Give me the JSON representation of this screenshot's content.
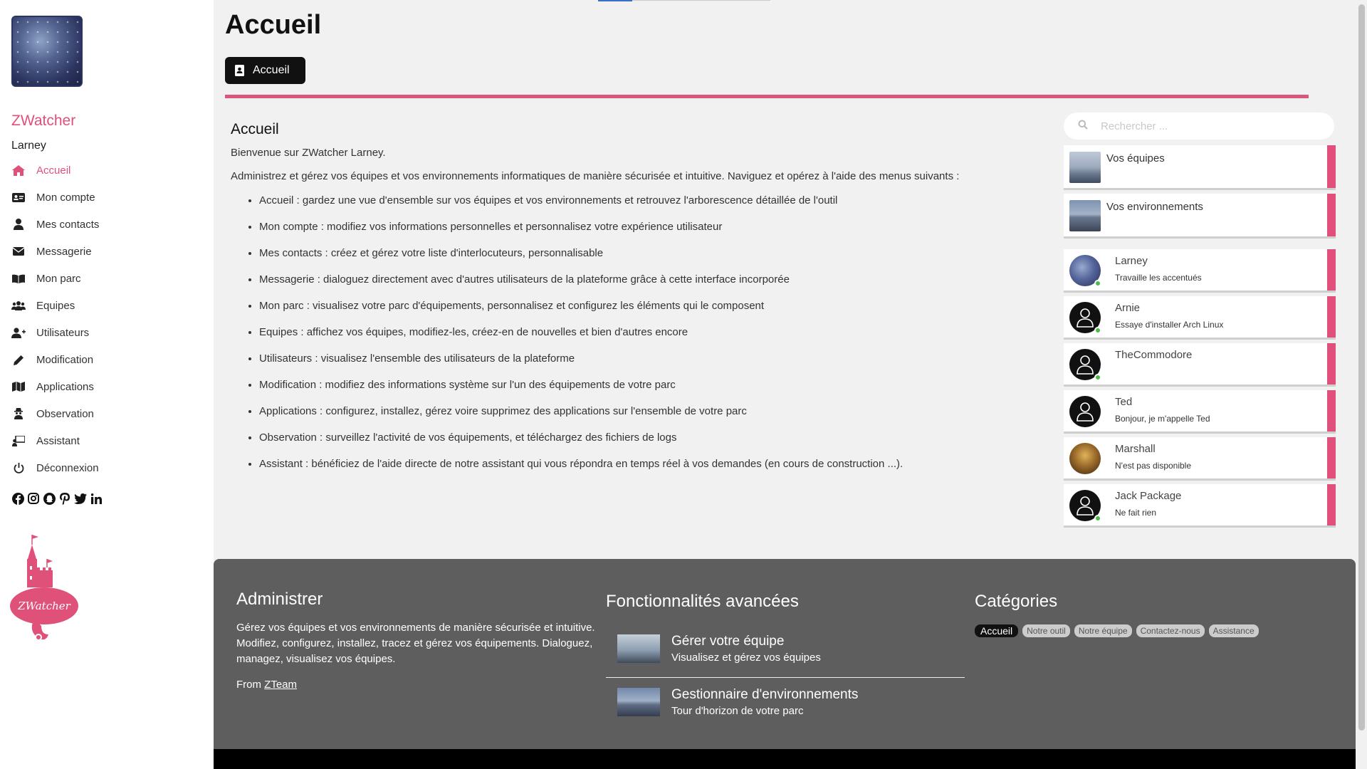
{
  "sidebar": {
    "app_name": "ZWatcher",
    "user_name": "Larney",
    "nav": [
      {
        "label": "Accueil",
        "icon": "home-icon",
        "active": true
      },
      {
        "label": "Mon compte",
        "icon": "id-card-icon"
      },
      {
        "label": "Mes contacts",
        "icon": "user-icon"
      },
      {
        "label": "Messagerie",
        "icon": "envelope-icon"
      },
      {
        "label": "Mon parc",
        "icon": "book-open-icon"
      },
      {
        "label": "Equipes",
        "icon": "users-icon"
      },
      {
        "label": "Utilisateurs",
        "icon": "user-plus-icon"
      },
      {
        "label": "Modification",
        "icon": "pencil-icon"
      },
      {
        "label": "Applications",
        "icon": "map-icon"
      },
      {
        "label": "Observation",
        "icon": "user-secret-icon"
      },
      {
        "label": "Assistant",
        "icon": "chalkboard-user-icon"
      },
      {
        "label": "Déconnexion",
        "icon": "power-icon"
      }
    ],
    "socials": [
      "facebook-icon",
      "instagram-icon",
      "snapchat-icon",
      "pinterest-icon",
      "twitter-icon",
      "linkedin-icon"
    ],
    "logo_text": "ZWatcher"
  },
  "header": {
    "title": "Accueil",
    "button_label": "Accueil"
  },
  "content": {
    "heading": "Accueil",
    "welcome": "Bienvenue sur ZWatcher Larney.",
    "intro": "Administrez et gérez vos équipes et vos environnements informatiques de manière sécurisée et intuitive. Naviguez et opérez à l'aide des menus suivants :",
    "items": [
      "Accueil : gardez une vue d'ensemble sur vos équipes et vos environnements et retrouvez l'arborescence détaillée de l'outil",
      "Mon compte : modifiez vos informations personnelles et personnalisez votre expérience utilisateur",
      "Mes contacts : créez et gérez votre liste d'interlocuteurs, personnalisable",
      "Messagerie : dialoguez directement avec d'autres utilisateurs de la plateforme grâce à cette interface incorporée",
      "Mon parc : visualisez votre parc d'équipements, personnalisez et configurez les éléments qui le composent",
      "Equipes : affichez vos équipes, modifiez-les, créez-en de nouvelles et bien d'autres encore",
      "Utilisateurs : visualisez l'ensemble des utilisateurs de la plateforme",
      "Modification : modifiez des informations système sur l'un des équipements de votre parc",
      "Applications : configurez, installez, gérez voire supprimez des applications sur l'ensemble de votre parc",
      "Observation : surveillez l'activité de vos équipements, et téléchargez des fichiers de logs",
      "Assistant : bénéficiez de l'aide directe de notre assistant qui vous répondra en temps réel à vos demandes (en cours de construction ...)."
    ]
  },
  "right_panel": {
    "search_placeholder": "Rechercher ...",
    "quick_links": [
      {
        "label": "Vos équipes"
      },
      {
        "label": "Vos environnements"
      }
    ],
    "users": [
      {
        "name": "Larney",
        "status": "Travaille les accentués",
        "online": true
      },
      {
        "name": "Arnie",
        "status": "Essaye d'installer Arch Linux",
        "online": true
      },
      {
        "name": "TheCommodore",
        "status": "",
        "online": true
      },
      {
        "name": "Ted",
        "status": "Bonjour, je m'appelle Ted",
        "online": false
      },
      {
        "name": "Marshall",
        "status": "N'est pas disponible",
        "online": false
      },
      {
        "name": "Jack Package",
        "status": "Ne fait rien",
        "online": true
      }
    ]
  },
  "footer": {
    "col1": {
      "title": "Administrer",
      "text": "Gérez vos équipes et vos environnements de manière sécurisée et intuitive. Modifiez, configurez, installez, tracez et gérez vos équipements. Dialoguez, managez, visualisez vos équipes.",
      "from_label": "From",
      "from_link": "ZTeam"
    },
    "col2": {
      "title": "Fonctionnalités avancées",
      "items": [
        {
          "title": "Gérer votre équipe",
          "subtitle": "Visualisez et gérez vos équipes"
        },
        {
          "title": "Gestionnaire d'environnements",
          "subtitle": "Tour d'horizon de votre parc"
        }
      ]
    },
    "col3": {
      "title": "Catégories",
      "tags": [
        "Accueil",
        "Notre outil",
        "Notre équipe",
        "Contactez-nous",
        "Assistance"
      ]
    }
  },
  "colors": {
    "accent": "#e0517a",
    "footer_bg": "#5e5e5e",
    "online": "#4cbb4c"
  }
}
